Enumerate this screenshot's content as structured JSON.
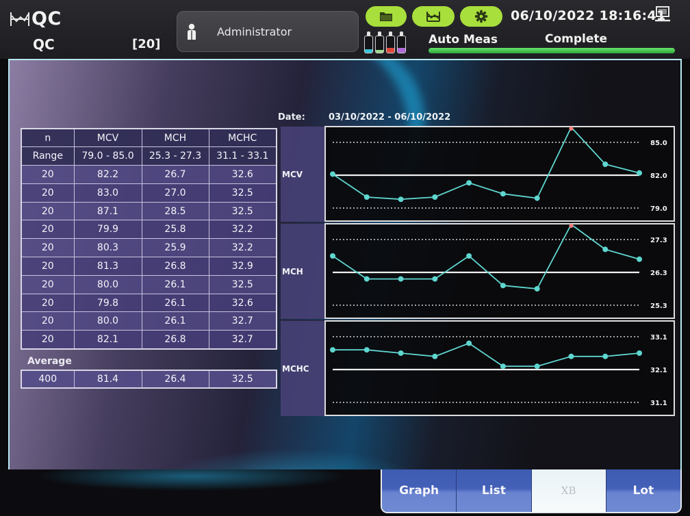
{
  "header": {
    "title": "QC",
    "subtitle": "QC",
    "count": "[20]",
    "user": "Administrator",
    "datetime": "06/10/2022 18:16:41",
    "toolbar_icons": [
      "folder-icon",
      "qc-chart-icon",
      "gear-icon"
    ],
    "reagent_colors": [
      "#35c6dc",
      "#9fdc8c",
      "#e04a3a",
      "#b06ad8"
    ],
    "status_left": "Auto Meas",
    "status_right": "Complete",
    "progress_percent": 100,
    "accent_color": "#a8df3c"
  },
  "main": {
    "date_label": "Date:",
    "date_range": "03/10/2022 - 06/10/2022",
    "table": {
      "headers": [
        "n",
        "MCV",
        "MCH",
        "MCHC"
      ],
      "range": [
        "Range",
        "79.0 - 85.0",
        "25.3 - 27.3",
        "31.1 - 33.1"
      ],
      "rows": [
        [
          "20",
          "82.2",
          "26.7",
          "32.6"
        ],
        [
          "20",
          "83.0",
          "27.0",
          "32.5"
        ],
        [
          "20",
          "87.1",
          "28.5",
          "32.5"
        ],
        [
          "20",
          "79.9",
          "25.8",
          "32.2"
        ],
        [
          "20",
          "80.3",
          "25.9",
          "32.2"
        ],
        [
          "20",
          "81.3",
          "26.8",
          "32.9"
        ],
        [
          "20",
          "80.0",
          "26.1",
          "32.5"
        ],
        [
          "20",
          "79.8",
          "26.1",
          "32.6"
        ],
        [
          "20",
          "80.0",
          "26.1",
          "32.7"
        ],
        [
          "20",
          "82.1",
          "26.8",
          "32.7"
        ]
      ],
      "average_label": "Average",
      "average": [
        "400",
        "81.4",
        "26.4",
        "32.5"
      ]
    }
  },
  "chart_data": [
    {
      "type": "line",
      "title": "MCV",
      "ylabel": "MCV",
      "ylim": [
        79.0,
        85.0
      ],
      "target": 82.0,
      "limits": [
        79.0,
        85.0
      ],
      "tick_labels": [
        "85.0",
        "82.0",
        "79.0"
      ],
      "series": [
        {
          "name": "MCV",
          "values": [
            82.1,
            80.0,
            79.8,
            80.0,
            81.3,
            80.3,
            79.9,
            87.1,
            83.0,
            82.2
          ]
        }
      ],
      "out_of_range_color": "#ff7b7b",
      "point_color": "#5fd6d0"
    },
    {
      "type": "line",
      "title": "MCH",
      "ylabel": "MCH",
      "ylim": [
        25.3,
        27.3
      ],
      "target": 26.3,
      "limits": [
        25.3,
        27.3
      ],
      "tick_labels": [
        "27.3",
        "26.3",
        "25.3"
      ],
      "series": [
        {
          "name": "MCH",
          "values": [
            26.8,
            26.1,
            26.1,
            26.1,
            26.8,
            25.9,
            25.8,
            28.5,
            27.0,
            26.7
          ]
        }
      ],
      "out_of_range_color": "#ff7b7b",
      "point_color": "#5fd6d0"
    },
    {
      "type": "line",
      "title": "MCHC",
      "ylabel": "MCHC",
      "ylim": [
        31.1,
        33.1
      ],
      "target": 32.1,
      "limits": [
        31.1,
        33.1
      ],
      "tick_labels": [
        "33.1",
        "32.1",
        "31.1"
      ],
      "series": [
        {
          "name": "MCHC",
          "values": [
            32.7,
            32.7,
            32.6,
            32.5,
            32.9,
            32.2,
            32.2,
            32.5,
            32.5,
            32.6
          ]
        }
      ],
      "out_of_range_color": "#ff7b7b",
      "point_color": "#5fd6d0"
    }
  ],
  "tabs": [
    {
      "label": "Graph",
      "active": false
    },
    {
      "label": "List",
      "active": false
    },
    {
      "label": "XB",
      "active": true
    },
    {
      "label": "Lot",
      "active": false
    }
  ]
}
